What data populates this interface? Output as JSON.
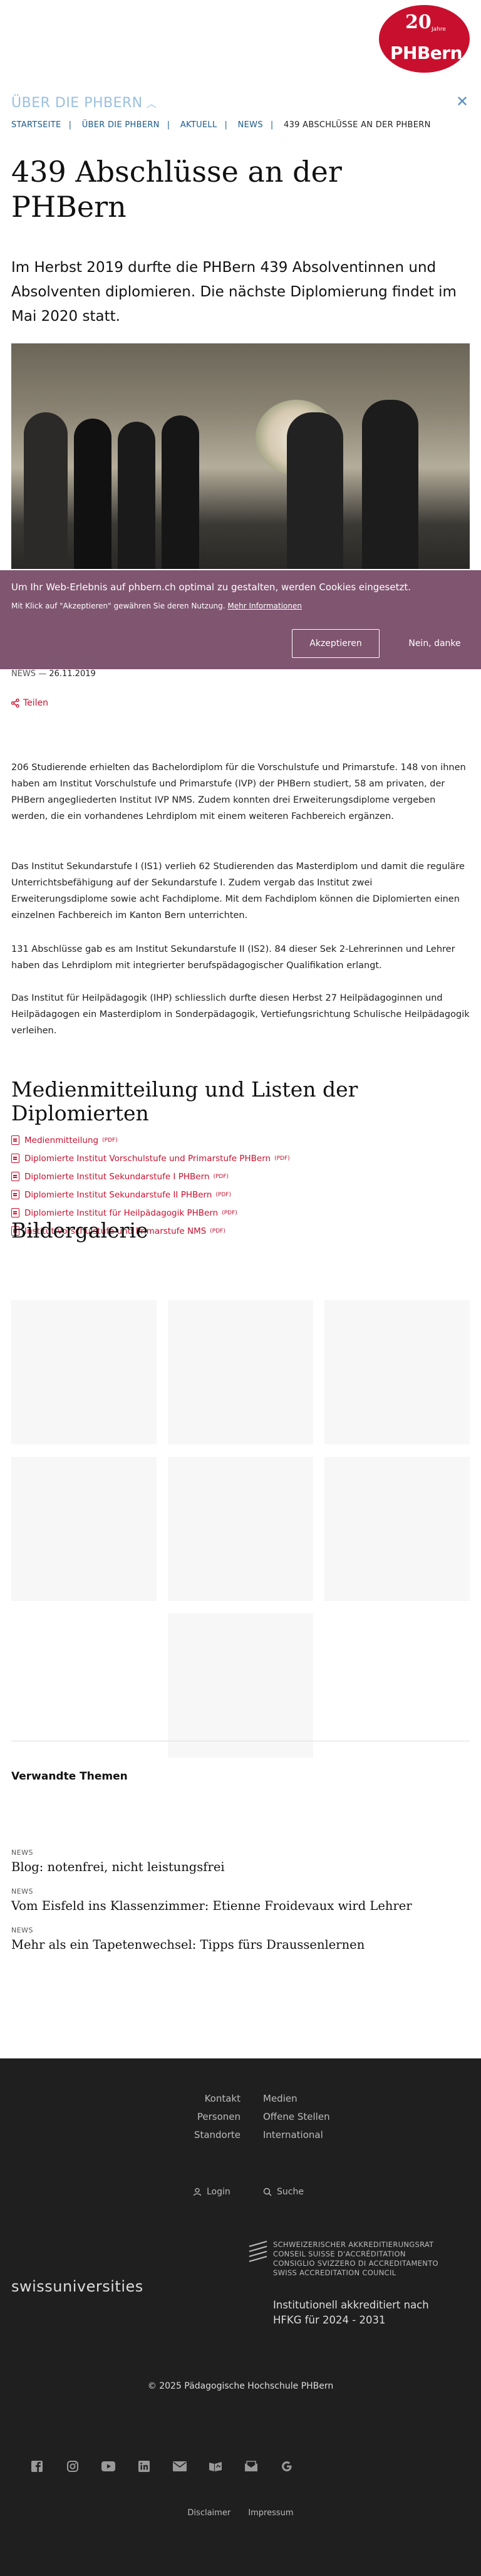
{
  "header": {
    "logo_number": "20",
    "logo_years": "Jahre",
    "logo_brand": "PHBern",
    "section_title": "ÜBER DIE PHBERN",
    "breadcrumb": [
      "STARTSEITE",
      "ÜBER DIE PHBERN",
      "AKTUELL",
      "NEWS",
      "439 ABSCHLÜSSE AN DER PHBERN"
    ]
  },
  "article": {
    "title": "439 Abschlüsse an der PHBern",
    "lead": "Im Herbst 2019 durfte die PHBern 439 Absolventinnen und Absolventen diplomieren. Die nächste Diplomierung findet im Mai 2020 statt.",
    "category": "NEWS",
    "date_separator": "—",
    "date": "26.11.2019",
    "share_label": "Teilen",
    "paragraphs": [
      "206 Studierende erhielten das Bachelordiplom für die Vorschulstufe und Primarstufe. 148 von ihnen haben am Institut Vorschulstufe und Primarstufe (IVP) der PHBern studiert, 58 am privaten, der PHBern angegliederten Institut IVP NMS. Zudem konnten drei Erweiterungsdiplome vergeben werden, die ein vorhandenes Lehrdiplom mit einem weiteren Fachbereich ergänzen.",
      "Das Institut Sekundarstufe I (IS1) verlieh 62 Studierenden das Masterdiplom und damit die reguläre Unterrichtsbefähigung auf der Sekundarstufe I. Zudem vergab das Institut zwei Erweiterungsdiplome sowie acht Fachdiplome. Mit dem Fachdiplom können die Diplomierten einen einzelnen Fachbereich im Kanton Bern unterrichten.",
      "131 Abschlüsse gab es am Institut Sekundarstufe II (IS2). 84 dieser Sek 2-Lehrerinnen und Lehrer haben das Lehrdiplom mit integrierter berufspädagogischer Qualifikation erlangt.",
      "Das Institut für Heilpädagogik (IHP) schliesslich durfte diesen Herbst 27 Heilpädagoginnen und Heilpädagogen ein Masterdiplom in Sonderpädagogik, Vertiefungsrichtung Schulische Heilpädagogik verleihen."
    ]
  },
  "cookie": {
    "text1": "Um Ihr Web-Erlebnis auf phbern.ch optimal zu gestalten, werden Cookies eingesetzt.",
    "text2": "Mit Klick auf \"Akzeptieren\" gewähren Sie deren Nutzung.",
    "more_link": "Mehr Informationen",
    "accept": "Akzeptieren",
    "deny": "Nein, danke"
  },
  "media": {
    "title": "Medienmitteilung und Listen der Diplomierten",
    "items": [
      {
        "label": "Medienmitteilung",
        "ext": "(PDF)"
      },
      {
        "label": "Diplomierte Institut Vorschulstufe und Primarstufe PHBern",
        "ext": "(PDF)"
      },
      {
        "label": "Diplomierte Institut Sekundarstufe I PHBern",
        "ext": "(PDF)"
      },
      {
        "label": "Diplomierte Institut Sekundarstufe II PHBern",
        "ext": "(PDF)"
      },
      {
        "label": "Diplomierte Institut für Heilpädagogik PHBern",
        "ext": "(PDF)"
      },
      {
        "label": "Institut Vorschulstufe und Primarstufe NMS",
        "ext": "(PDF)"
      }
    ]
  },
  "gallery": {
    "title": "Bildergalerie"
  },
  "related": {
    "title": "Verwandte Themen",
    "items": [
      {
        "kicker": "NEWS",
        "title": "Blog: notenfrei, nicht leistungsfrei"
      },
      {
        "kicker": "NEWS",
        "title": "Vom Eisfeld ins Klassenzimmer: Etienne Froidevaux wird Lehrer"
      },
      {
        "kicker": "NEWS",
        "title": "Mehr als ein Tapetenwechsel: Tipps fürs Draussenlernen"
      }
    ]
  },
  "footer": {
    "links_left": [
      "Kontakt",
      "Personen",
      "Standorte"
    ],
    "links_right": [
      "Medien",
      "Offene Stellen",
      "International"
    ],
    "login": "Login",
    "search": "Suche",
    "swissuniversities": "swissuniversities",
    "accreditation_lines": [
      "SCHWEIZERISCHER AKKREDITIERUNGSRAT",
      "CONSEIL SUISSE D'ACCRÉDITATION",
      "CONSIGLIO SVIZZERO DI ACCREDITAMENTO",
      "SWISS ACCREDITATION COUNCIL"
    ],
    "accredited_line1": "Institutionell akkreditiert nach",
    "accredited_line2": "HFKG für 2024 - 2031",
    "copyright": "© 2025 Pädagogische Hochschule PHBern",
    "socials": [
      "facebook-icon",
      "instagram-icon",
      "youtube-icon",
      "linkedin-icon",
      "mail-icon",
      "podcast-icon",
      "newsletter-icon",
      "google-icon"
    ],
    "legal": [
      "Disclaimer",
      "Impressum"
    ]
  },
  "colors": {
    "brand_red": "#c8102e",
    "cookie_bg": "#7f5570",
    "footer_bg": "#1f1f1f",
    "link_blue": "#1a5a8a"
  }
}
